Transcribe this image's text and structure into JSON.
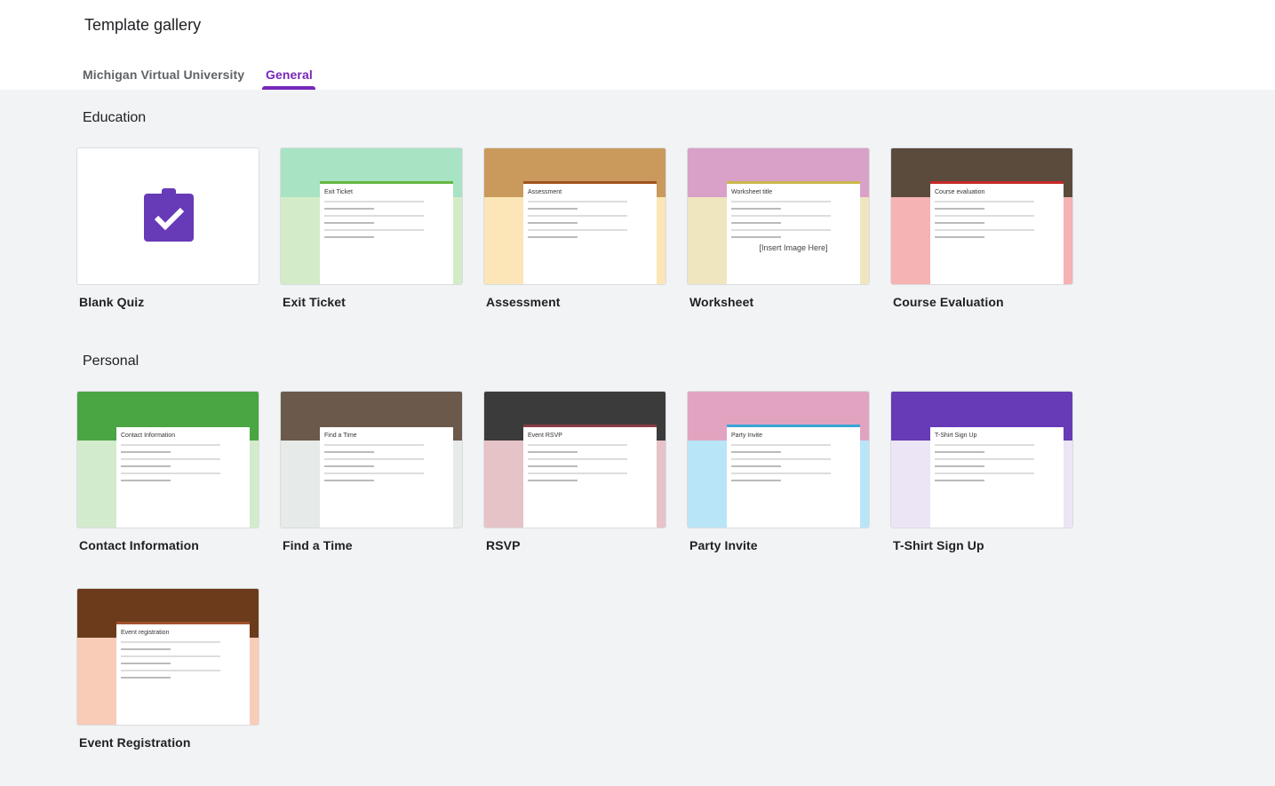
{
  "header": {
    "title": "Template gallery",
    "tabs": [
      {
        "label": "Michigan Virtual University",
        "active": false
      },
      {
        "label": "General",
        "active": true
      }
    ]
  },
  "accent": "#7627bb",
  "sections": [
    {
      "title": "Education",
      "templates": [
        {
          "label": "Blank Quiz",
          "icon": "quiz-clipboard-check-icon",
          "color": "#673ab7"
        },
        {
          "label": "Exit Ticket",
          "form_title": "Exit Ticket",
          "banner": "#a8e3c4",
          "side": "#d3ecc7",
          "accent": "#64b843"
        },
        {
          "label": "Assessment",
          "form_title": "Assessment",
          "banner": "#c99a5b",
          "side": "#fce5b6",
          "accent": "#a0521d"
        },
        {
          "label": "Worksheet",
          "form_title": "Worksheet title",
          "banner": "#d9a0c8",
          "side": "#efe5bf",
          "accent": "#c9b84a",
          "extra": "[Insert Image Here]"
        },
        {
          "label": "Course Evaluation",
          "form_title": "Course evaluation",
          "banner": "#5b4b3c",
          "side": "#f5b3b3",
          "accent": "#c62828"
        }
      ]
    },
    {
      "title": "Personal",
      "templates": [
        {
          "label": "Contact Information",
          "form_title": "Contact Information",
          "banner": "#4aa543",
          "side": "#d2ebcd",
          "accent": "#4aa543"
        },
        {
          "label": "Find a Time",
          "form_title": "Find a Time",
          "banner": "#6b5a4b",
          "side": "#e6eae8",
          "accent": "#6b5a4b"
        },
        {
          "label": "RSVP",
          "form_title": "Event RSVP",
          "banner": "#3b3b3b",
          "side": "#e5c3c7",
          "accent": "#8a3b45"
        },
        {
          "label": "Party Invite",
          "form_title": "Party Invite",
          "banner": "#e2a3c0",
          "side": "#b9e5f8",
          "accent": "#39a5d6"
        },
        {
          "label": "T-Shirt Sign Up",
          "form_title": "T-Shirt Sign Up",
          "banner": "#673ab7",
          "side": "#ebe5f5",
          "accent": "#673ab7"
        }
      ]
    },
    {
      "title": "",
      "templates": [
        {
          "label": "Event Registration",
          "form_title": "Event registration",
          "banner": "#6b3b1c",
          "side": "#f8ccb7",
          "accent": "#a0522d"
        }
      ]
    }
  ]
}
